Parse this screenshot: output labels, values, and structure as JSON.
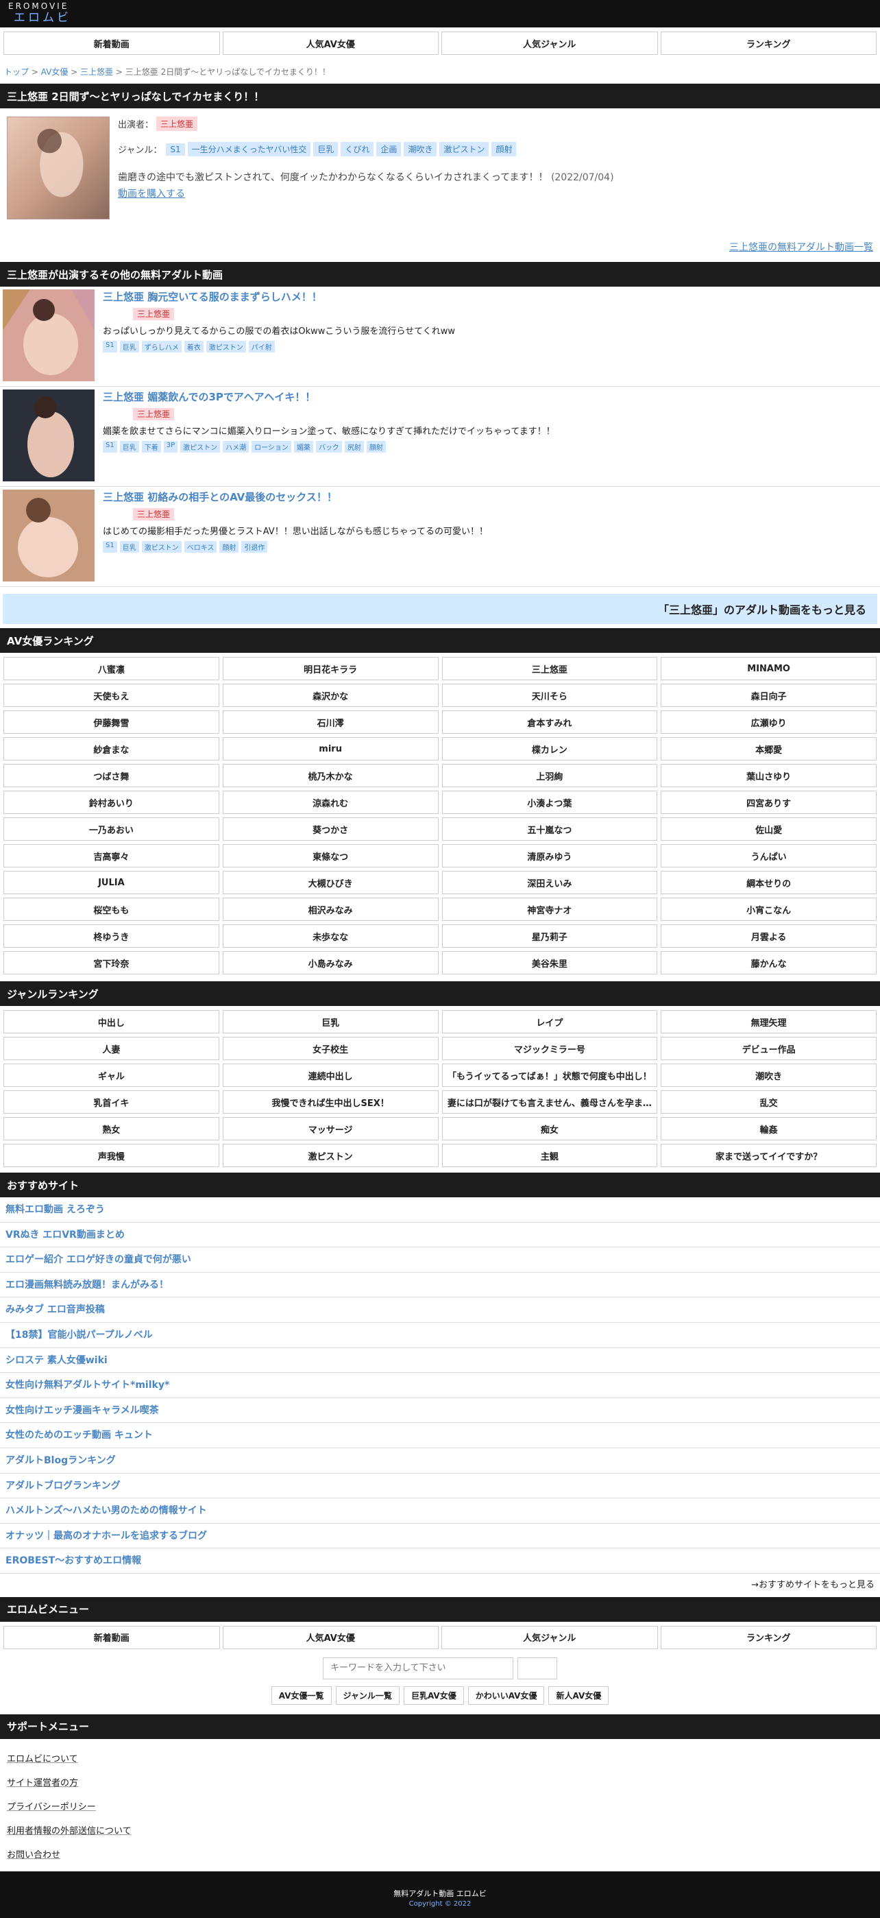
{
  "header": {
    "logo_en": "EROMOVIE",
    "logo_ja": "エロムビ"
  },
  "nav": [
    "新着動画",
    "人気AV女優",
    "人気ジャンル",
    "ランキング"
  ],
  "breadcrumb": {
    "home": "トップ",
    "sep": " > ",
    "cat": "AV女優",
    "actress": "三上悠亜",
    "current": "三上悠亜 2日間ず〜とヤリっぱなしでイカセまくり！！"
  },
  "main": {
    "title": "三上悠亜 2日間ず〜とヤリっぱなしでイカセまくり！！",
    "performer_label": "出演者：",
    "performer": "三上悠亜",
    "genre_label": "ジャンル：",
    "genres": [
      "S1",
      "一生分ハメまくったヤバい性交",
      "巨乳",
      "くびれ",
      "企画",
      "潮吹き",
      "激ピストン",
      "顔射"
    ],
    "description": "歯磨きの途中でも激ピストンされて、何度イッたかわからなくなるくらいイカされまくってます！！",
    "date": "(2022/07/04)",
    "buy_link": "動画を購入する",
    "more_link": "三上悠亜の無料アダルト動画一覧"
  },
  "related": {
    "heading": "三上悠亜が出演するその他の無料アダルト動画",
    "items": [
      {
        "title": "三上悠亜 胸元空いてる服のままずらしハメ！！",
        "actress": "三上悠亜",
        "desc": "おっぱいしっかり見えてるからこの服での着衣はOkwwこういう服を流行らせてくれww",
        "tags": [
          "S1",
          "巨乳",
          "ずらしハメ",
          "着衣",
          "激ピストン",
          "パイ射"
        ]
      },
      {
        "title": "三上悠亜 媚薬飲んでの3Pでアヘアヘイキ！！",
        "actress": "三上悠亜",
        "desc": "媚薬を飲ませてさらにマンコに媚薬入りローション塗って、敏感になりすぎて挿れただけでイッちゃってます！！",
        "tags": [
          "S1",
          "巨乳",
          "下着",
          "3P",
          "激ピストン",
          "ハメ潮",
          "ローション",
          "媚薬",
          "バック",
          "尻射",
          "顔射"
        ]
      },
      {
        "title": "三上悠亜 初絡みの相手とのAV最後のセックス！！",
        "actress": "三上悠亜",
        "desc": "はじめての撮影相手だった男優とラストAV！！思い出話しながらも感じちゃってるの可愛い！！",
        "tags": [
          "S1",
          "巨乳",
          "激ピストン",
          "ベロキス",
          "顔射",
          "引退作"
        ]
      }
    ],
    "more": "「三上悠亜」のアダルト動画をもっと見る"
  },
  "actress_ranking": {
    "heading": "AV女優ランキング",
    "items": [
      "八蜜凛",
      "明日花キララ",
      "三上悠亜",
      "MINAMO",
      "天使もえ",
      "森沢かな",
      "天川そら",
      "森日向子",
      "伊藤舞雪",
      "石川澪",
      "倉本すみれ",
      "広瀬ゆり",
      "紗倉まな",
      "miru",
      "楪カレン",
      "本郷愛",
      "つばさ舞",
      "桃乃木かな",
      "上羽絢",
      "葉山さゆり",
      "鈴村あいり",
      "涼森れむ",
      "小湊よつ葉",
      "四宮ありす",
      "一乃あおい",
      "葵つかさ",
      "五十嵐なつ",
      "佐山愛",
      "吉高寧々",
      "東條なつ",
      "清原みゆう",
      "うんぱい",
      "JULIA",
      "大槻ひびき",
      "深田えいみ",
      "綱本せりの",
      "桜空もも",
      "相沢みなみ",
      "神宮寺ナオ",
      "小宵こなん",
      "柊ゆうき",
      "未歩なな",
      "星乃莉子",
      "月雲よる",
      "宮下玲奈",
      "小島みなみ",
      "美谷朱里",
      "藤かんな"
    ]
  },
  "genre_ranking": {
    "heading": "ジャンルランキング",
    "items": [
      "中出し",
      "巨乳",
      "レイプ",
      "無理矢理",
      "人妻",
      "女子校生",
      "マジックミラー号",
      "デビュー作品",
      "ギャル",
      "連続中出し",
      "「もうイッてるってばぁ！」状態で何度も中出し！",
      "潮吹き",
      "乳首イキ",
      "我慢できれば生中出しSEX！",
      "妻には口が裂けても言えません、義母さんを孕ま…",
      "乱交",
      "熟女",
      "マッサージ",
      "痴女",
      "輪姦",
      "声我慢",
      "激ピストン",
      "主観",
      "家まで送ってイイですか？"
    ]
  },
  "recommended": {
    "heading": "おすすめサイト",
    "items": [
      "無料エロ動画 えろぞう",
      "VRぬき エロVR動画まとめ",
      "エロゲー紹介 エロゲ好きの童貞で何が悪い",
      "エロ漫画無料読み放題！まんがみる！",
      "みみタブ エロ音声投稿",
      "【18禁】官能小説パープルノベル",
      "シロステ 素人女優wiki",
      "女性向け無料アダルトサイト*milky*",
      "女性向けエッチ漫画キャラメル喫茶",
      "女性のためのエッチ動画 キュント",
      "アダルトBlogランキング",
      "アダルトブログランキング",
      "ハメルトンズ〜ハメたい男のための情報サイト",
      "オナッツ｜最高のオナホールを追求するブログ",
      "EROBEST〜おすすめエロ情報"
    ],
    "more": "→おすすめサイトをもっと見る"
  },
  "menu": {
    "heading": "エロムビメニュー",
    "search_placeholder": "キーワードを入力して下さい",
    "chips": [
      "AV女優一覧",
      "ジャンル一覧",
      "巨乳AV女優",
      "かわいいAV女優",
      "新人AV女優"
    ]
  },
  "support": {
    "heading": "サポートメニュー",
    "items": [
      "エロムビについて",
      "サイト運営者の方",
      "プライバシーポリシー",
      "利用者情報の外部送信について",
      "お問い合わせ"
    ]
  },
  "footer": {
    "title": "無料アダルト動画 エロムビ",
    "copy": "Copyright © 2022"
  }
}
